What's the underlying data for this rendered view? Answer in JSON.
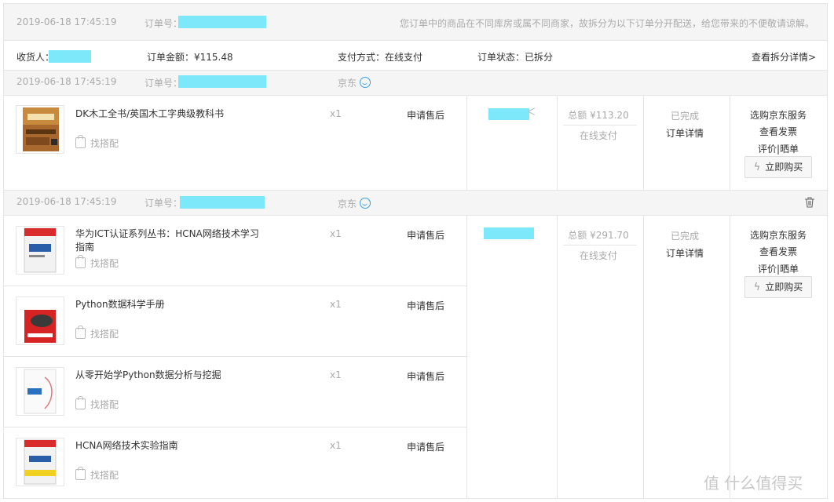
{
  "header": {
    "time": "2019-06-18 17:45:19",
    "order_no_label": "订单号：",
    "notice": "您订单中的商品在不同库房或属不同商家，故拆分为以下订单分开配送，给您带来的不便敬请谅解。",
    "receiver_label": "收货人：",
    "amount": "订单金额：¥115.48",
    "payment": "支付方式：在线支付",
    "status": "订单状态：已拆分",
    "split_link": "查看拆分详情>"
  },
  "orders": [
    {
      "time": "2019-06-18 17:45:19",
      "order_no_label": "订单号：",
      "shop": "京东",
      "total": "总额 ¥113.20",
      "pay": "在线支付",
      "status": "已完成",
      "detail": "订单详情",
      "ops": [
        "选购京东服务",
        "查看发票",
        "评价|晒单"
      ],
      "buy": "立即购买",
      "items": [
        {
          "name": "DK木工全书/英国木工字典级教科书",
          "qty": "x1",
          "after_sale": "申请售后",
          "match": "找搭配"
        }
      ]
    },
    {
      "time": "2019-06-18 17:45:19",
      "order_no_label": "订单号：",
      "shop": "京东",
      "total": "总额 ¥291.70",
      "pay": "在线支付",
      "status": "已完成",
      "detail": "订单详情",
      "ops": [
        "选购京东服务",
        "查看发票",
        "评价|晒单"
      ],
      "buy": "立即购买",
      "items": [
        {
          "name": "华为ICT认证系列丛书：HCNA网络技术学习指南",
          "qty": "x1",
          "after_sale": "申请售后",
          "match": "找搭配"
        },
        {
          "name": "Python数据科学手册",
          "qty": "x1",
          "after_sale": "申请售后",
          "match": "找搭配"
        },
        {
          "name": "从零开始学Python数据分析与挖掘",
          "qty": "x1",
          "after_sale": "申请售后",
          "match": "找搭配"
        },
        {
          "name": "HCNA网络技术实验指南",
          "qty": "x1",
          "after_sale": "申请售后",
          "match": "找搭配"
        }
      ]
    }
  ],
  "watermark": "值 什么值得买",
  "colors": {
    "mask": "#7ee8fb",
    "accent": "#3aa0e0",
    "gray_text": "#aaaaaa"
  }
}
